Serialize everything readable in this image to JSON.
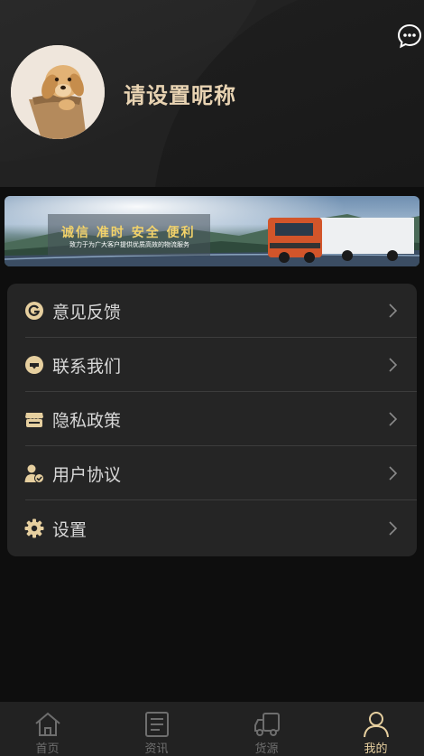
{
  "profile": {
    "nickname": "请设置昵称"
  },
  "banner": {
    "title": "诚信 准时 安全 便利",
    "subtitle": "致力于为广大客户提供优质高效的物流服务"
  },
  "menu": {
    "items": [
      {
        "label": "意见反馈",
        "icon": "feedback-g-icon"
      },
      {
        "label": "联系我们",
        "icon": "chat-bubble-icon"
      },
      {
        "label": "隐私政策",
        "icon": "store-icon"
      },
      {
        "label": "用户协议",
        "icon": "user-check-icon"
      },
      {
        "label": "设置",
        "icon": "gear-icon"
      }
    ]
  },
  "tabbar": {
    "tabs": [
      {
        "label": "首页",
        "icon": "home-icon"
      },
      {
        "label": "资讯",
        "icon": "news-icon"
      },
      {
        "label": "货源",
        "icon": "truck-icon"
      },
      {
        "label": "我的",
        "icon": "person-icon"
      }
    ],
    "active_index": 3
  },
  "colors": {
    "accent": "#e6cf9f",
    "background": "#0e0e0e",
    "card": "#252525"
  }
}
